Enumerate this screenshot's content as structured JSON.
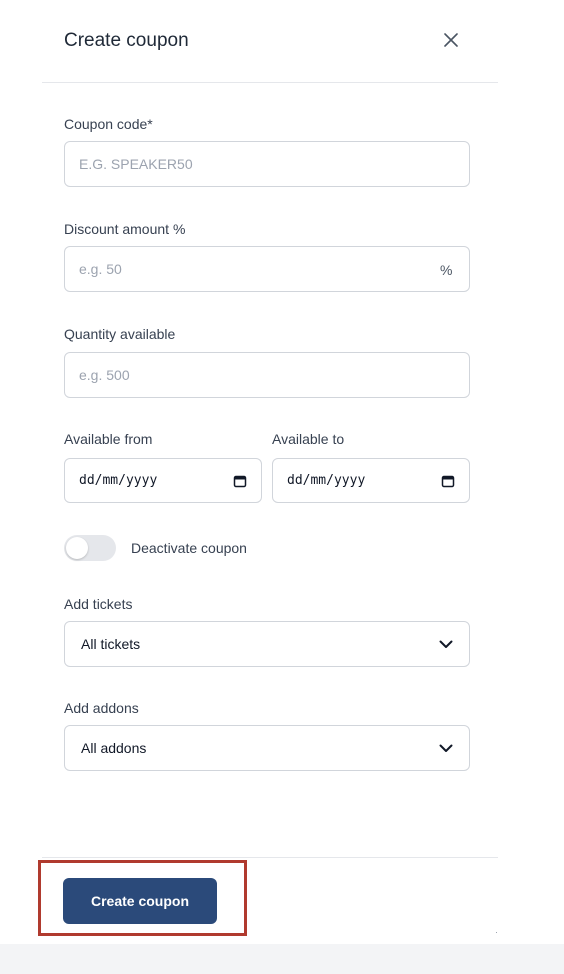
{
  "header": {
    "title": "Create coupon",
    "close_icon": "close-icon"
  },
  "form": {
    "coupon_code": {
      "label": "Coupon code*",
      "value": "",
      "placeholder": "E.G. SPEAKER50"
    },
    "discount": {
      "label": "Discount amount %",
      "value": "",
      "placeholder": "e.g. 50",
      "suffix": "%"
    },
    "quantity": {
      "label": "Quantity available",
      "value": "",
      "placeholder": "e.g. 500"
    },
    "available_from": {
      "label": "Available from",
      "value": "dd/mm/yyyy",
      "icon": "calendar-icon"
    },
    "available_to": {
      "label": "Available to",
      "value": "dd/mm/yyyy",
      "icon": "calendar-icon"
    },
    "deactivate": {
      "label": "Deactivate coupon",
      "checked": false
    },
    "tickets": {
      "label": "Add tickets",
      "selected": "All tickets",
      "icon": "chevron-down-icon"
    },
    "addons": {
      "label": "Add addons",
      "selected": "All addons",
      "icon": "chevron-down-icon"
    }
  },
  "footer": {
    "submit_label": "Create coupon"
  },
  "colors": {
    "primary": "#2b4a7a",
    "highlight": "#b03a2e",
    "border": "#d1d5db"
  }
}
